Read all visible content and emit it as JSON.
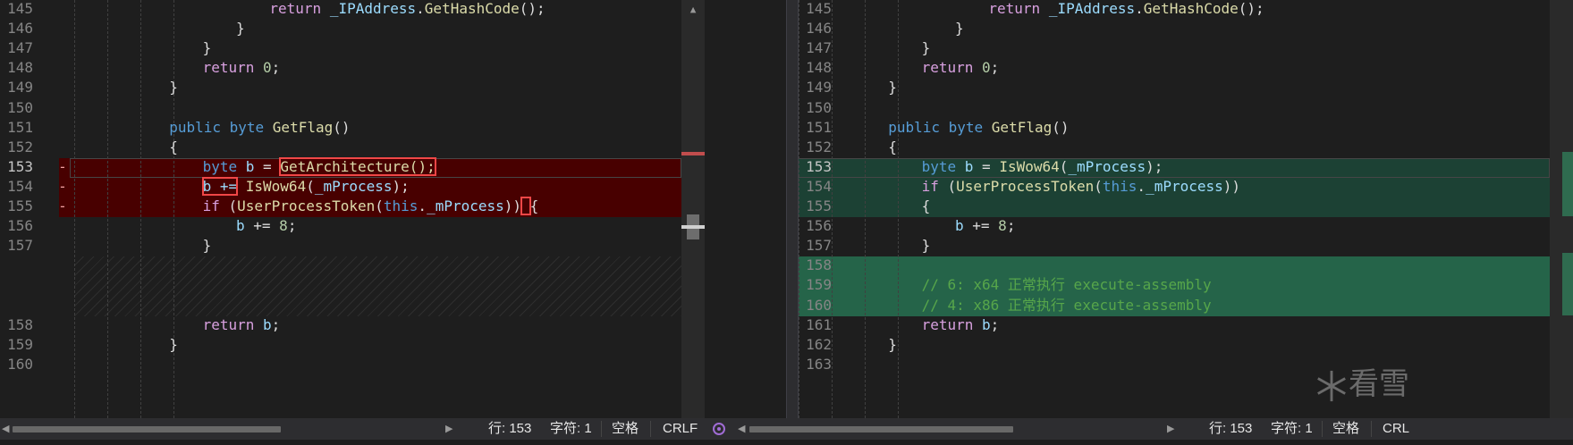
{
  "left_pane": {
    "lines": [
      {
        "n": "145",
        "tokens": [
          [
            "k2",
            "return"
          ],
          [
            "p",
            " "
          ],
          [
            "v",
            "_IPAddress"
          ],
          [
            "p",
            "."
          ],
          [
            "f",
            "GetHashCode"
          ],
          [
            "p",
            "();"
          ]
        ],
        "indent": 6
      },
      {
        "n": "146",
        "tokens": [
          [
            "p",
            "}"
          ]
        ],
        "indent": 5
      },
      {
        "n": "147",
        "tokens": [
          [
            "p",
            "}"
          ]
        ],
        "indent": 4
      },
      {
        "n": "148",
        "tokens": [
          [
            "k2",
            "return"
          ],
          [
            "p",
            " "
          ],
          [
            "n",
            "0"
          ],
          [
            "p",
            ";"
          ]
        ],
        "indent": 4
      },
      {
        "n": "149",
        "tokens": [
          [
            "p",
            "}"
          ]
        ],
        "indent": 3
      },
      {
        "n": "150",
        "tokens": [],
        "indent": 0
      },
      {
        "n": "151",
        "tokens": [
          [
            "k",
            "public"
          ],
          [
            "p",
            " "
          ],
          [
            "k",
            "byte"
          ],
          [
            "p",
            " "
          ],
          [
            "f",
            "GetFlag"
          ],
          [
            "p",
            "()"
          ]
        ],
        "indent": 3
      },
      {
        "n": "152",
        "tokens": [
          [
            "p",
            "{"
          ]
        ],
        "indent": 3
      },
      {
        "n": "153",
        "marker": "-",
        "tokens": [
          [
            "k",
            "byte"
          ],
          [
            "p",
            " "
          ],
          [
            "v",
            "b"
          ],
          [
            "p",
            " = "
          ],
          [
            "fh",
            "GetArchitecture();"
          ]
        ],
        "indent": 4
      },
      {
        "n": "154",
        "marker": "-",
        "tokens": [
          [
            "vh",
            "b +="
          ],
          [
            "p",
            " "
          ],
          [
            "f",
            "IsWow64"
          ],
          [
            "p",
            "("
          ],
          [
            "v",
            "_mProcess"
          ],
          [
            "p",
            ");"
          ]
        ],
        "indent": 4
      },
      {
        "n": "155",
        "marker": "-",
        "tokens": [
          [
            "k2",
            "if"
          ],
          [
            "p",
            " ("
          ],
          [
            "f",
            "UserProcessToken"
          ],
          [
            "p",
            "("
          ],
          [
            "k",
            "this"
          ],
          [
            "p",
            "."
          ],
          [
            "v",
            "_mProcess"
          ],
          [
            "p",
            "))"
          ],
          [
            "ph",
            " "
          ],
          [
            "p",
            "{"
          ]
        ],
        "indent": 4
      },
      {
        "n": "156",
        "tokens": [
          [
            "v",
            "b"
          ],
          [
            "p",
            " += "
          ],
          [
            "n",
            "8"
          ],
          [
            "p",
            ";"
          ]
        ],
        "indent": 5
      },
      {
        "n": "157",
        "tokens": [
          [
            "p",
            "}"
          ]
        ],
        "indent": 4
      },
      {
        "n": "158",
        "tokens": [
          [
            "k2",
            "return"
          ],
          [
            "p",
            " "
          ],
          [
            "v",
            "b"
          ],
          [
            "p",
            ";"
          ]
        ],
        "indent": 4
      },
      {
        "n": "159",
        "tokens": [
          [
            "p",
            "}"
          ]
        ],
        "indent": 3
      },
      {
        "n": "160",
        "tokens": [],
        "indent": 0
      }
    ]
  },
  "right_pane": {
    "lines": [
      {
        "n": "145",
        "tokens": [
          [
            "k2",
            "return"
          ],
          [
            "p",
            " "
          ],
          [
            "v",
            "_IPAddress"
          ],
          [
            "p",
            "."
          ],
          [
            "f",
            "GetHashCode"
          ],
          [
            "p",
            "();"
          ]
        ],
        "indent": 6
      },
      {
        "n": "146",
        "tokens": [
          [
            "p",
            "}"
          ]
        ],
        "indent": 5
      },
      {
        "n": "147",
        "tokens": [
          [
            "p",
            "}"
          ]
        ],
        "indent": 4
      },
      {
        "n": "148",
        "tokens": [
          [
            "k2",
            "return"
          ],
          [
            "p",
            " "
          ],
          [
            "n",
            "0"
          ],
          [
            "p",
            ";"
          ]
        ],
        "indent": 4
      },
      {
        "n": "149",
        "tokens": [
          [
            "p",
            "}"
          ]
        ],
        "indent": 3
      },
      {
        "n": "150",
        "tokens": [],
        "indent": 0
      },
      {
        "n": "151",
        "tokens": [
          [
            "k",
            "public"
          ],
          [
            "p",
            " "
          ],
          [
            "k",
            "byte"
          ],
          [
            "p",
            " "
          ],
          [
            "f",
            "GetFlag"
          ],
          [
            "p",
            "()"
          ]
        ],
        "indent": 3
      },
      {
        "n": "152",
        "tokens": [
          [
            "p",
            "{"
          ]
        ],
        "indent": 3
      },
      {
        "n": "153",
        "marker": "+",
        "tokens": [
          [
            "k",
            "byte"
          ],
          [
            "p",
            " "
          ],
          [
            "v",
            "b"
          ],
          [
            "p",
            " = "
          ],
          [
            "f",
            "IsWow64"
          ],
          [
            "p",
            "("
          ],
          [
            "v",
            "_mProcess"
          ],
          [
            "p",
            ");"
          ]
        ],
        "indent": 4
      },
      {
        "n": "154",
        "marker": "+",
        "tokens": [
          [
            "k2",
            "if"
          ],
          [
            "p",
            " ("
          ],
          [
            "f",
            "UserProcessToken"
          ],
          [
            "p",
            "("
          ],
          [
            "k",
            "this"
          ],
          [
            "p",
            "."
          ],
          [
            "v",
            "_mProcess"
          ],
          [
            "p",
            "))"
          ]
        ],
        "indent": 4
      },
      {
        "n": "155",
        "marker": "+",
        "tokens": [
          [
            "p",
            "{"
          ]
        ],
        "indent": 4
      },
      {
        "n": "156",
        "tokens": [
          [
            "v",
            "b"
          ],
          [
            "p",
            " += "
          ],
          [
            "n",
            "8"
          ],
          [
            "p",
            ";"
          ]
        ],
        "indent": 5
      },
      {
        "n": "157",
        "tokens": [
          [
            "p",
            "}"
          ]
        ],
        "indent": 4
      },
      {
        "n": "158",
        "marker": "+",
        "tokens": [],
        "indent": 0
      },
      {
        "n": "159",
        "marker": "+",
        "tokens": [
          [
            "c",
            "// 6: x64 正常执行 execute-assembly"
          ]
        ],
        "indent": 4
      },
      {
        "n": "160",
        "marker": "+",
        "tokens": [
          [
            "c",
            "// 4: x86 正常执行 execute-assembly"
          ]
        ],
        "indent": 4
      },
      {
        "n": "161",
        "tokens": [
          [
            "k2",
            "return"
          ],
          [
            "p",
            " "
          ],
          [
            "v",
            "b"
          ],
          [
            "p",
            ";"
          ]
        ],
        "indent": 4
      },
      {
        "n": "162",
        "tokens": [
          [
            "p",
            "}"
          ]
        ],
        "indent": 3
      },
      {
        "n": "163",
        "tokens": [],
        "indent": 0
      }
    ]
  },
  "status_left": {
    "line": "行: 153",
    "char": "字符: 1",
    "spaces": "空格",
    "eol": "CRLF"
  },
  "status_right": {
    "line": "行: 153",
    "char": "字符: 1",
    "spaces": "空格",
    "eol": "CRL"
  },
  "watermark": {
    "text": "看雪"
  },
  "colors": {
    "deleted": "#480000",
    "added": "#1c4134",
    "highlight": "#f04747"
  }
}
